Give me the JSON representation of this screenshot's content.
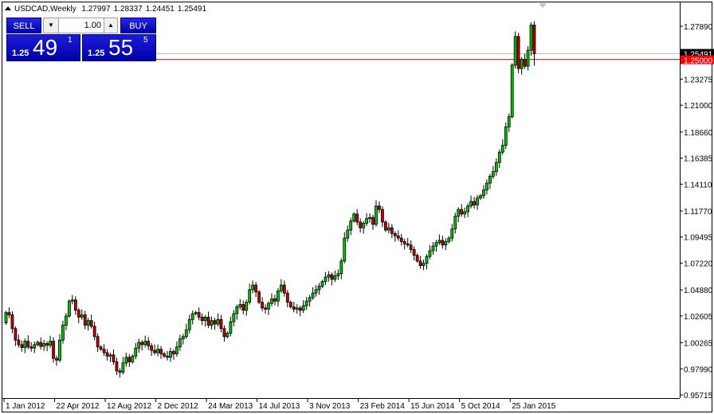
{
  "header": {
    "symbol": "USDCAD,Weekly",
    "open": "1.27997",
    "high": "1.28337",
    "low": "1.24451",
    "close": "1.25491"
  },
  "trade_panel": {
    "sell_label": "SELL",
    "buy_label": "BUY",
    "lot": "1.00",
    "sell_prefix": "1.25",
    "sell_big": "49",
    "sell_pip": "1",
    "buy_prefix": "1.25",
    "buy_big": "55",
    "buy_pip": "5"
  },
  "colors": {
    "bull": "#00c800",
    "bear": "#c80000",
    "ask_line": "#ff0000",
    "bid_line": "#c0c0c0",
    "panel_blue": "#0000c8"
  },
  "chart_data": {
    "type": "candlestick",
    "symbol": "USDCAD",
    "timeframe": "Weekly",
    "ylim": [
      0.95715,
      1.2789
    ],
    "y_ticks": [
      "1.27890",
      "1.23275",
      "1.21000",
      "1.18660",
      "1.16385",
      "1.14110",
      "1.11770",
      "1.09495",
      "1.07220",
      "1.04880",
      "1.02605",
      "1.00265",
      "0.97990",
      "0.95715"
    ],
    "x_ticks": [
      {
        "label": "1 Jan 2012",
        "week": 0
      },
      {
        "label": "22 Apr 2012",
        "week": 16
      },
      {
        "label": "12 Aug 2012",
        "week": 32
      },
      {
        "label": "2 Dec 2012",
        "week": 48
      },
      {
        "label": "24 Mar 2013",
        "week": 64
      },
      {
        "label": "14 Jul 2013",
        "week": 80
      },
      {
        "label": "3 Nov 2013",
        "week": 96
      },
      {
        "label": "23 Feb 2014",
        "week": 112
      },
      {
        "label": "15 Jun 2014",
        "week": 128
      },
      {
        "label": "5 Oct 2014",
        "week": 144
      },
      {
        "label": "25 Jan 2015",
        "week": 160
      }
    ],
    "bid_label": "1.25491",
    "bid": 1.25491,
    "level_label": "1.25000",
    "level": 1.25,
    "first_open": 1.02,
    "typical_wick": 0.004,
    "last_candle": {
      "open": 1.27997,
      "high": 1.28337,
      "low": 1.24451,
      "close": 1.25491
    },
    "close": [
      1.029,
      1.027,
      1.015,
      1.005,
      1.001,
      0.9985,
      1.004,
      0.999,
      0.998,
      1.001,
      1.003,
      0.9995,
      1.002,
      1.0005,
      1.004,
      0.989,
      0.9875,
      1.005,
      1.018,
      1.026,
      1.039,
      1.04,
      1.031,
      1.025,
      1.027,
      1.018,
      1.022,
      1.017,
      1.008,
      0.999,
      0.997,
      0.994,
      0.991,
      0.992,
      0.986,
      0.978,
      0.977,
      0.985,
      0.99,
      0.986,
      0.991,
      0.998,
      1.003,
      1.001,
      1.004,
      1.0,
      0.996,
      0.994,
      0.997,
      0.993,
      0.991,
      0.99,
      0.995,
      0.993,
      0.999,
      1.006,
      1.008,
      1.014,
      1.023,
      1.028,
      1.029,
      1.025,
      1.022,
      1.025,
      1.018,
      1.022,
      1.019,
      1.023,
      1.015,
      1.008,
      1.011,
      1.021,
      1.028,
      1.034,
      1.036,
      1.031,
      1.038,
      1.049,
      1.053,
      1.047,
      1.038,
      1.033,
      1.032,
      1.037,
      1.041,
      1.039,
      1.048,
      1.053,
      1.046,
      1.038,
      1.034,
      1.032,
      1.033,
      1.031,
      1.035,
      1.039,
      1.042,
      1.046,
      1.049,
      1.052,
      1.056,
      1.06,
      1.062,
      1.058,
      1.061,
      1.063,
      1.074,
      1.094,
      1.101,
      1.109,
      1.115,
      1.108,
      1.103,
      1.107,
      1.111,
      1.112,
      1.106,
      1.122,
      1.119,
      1.108,
      1.101,
      1.103,
      1.098,
      1.096,
      1.094,
      1.091,
      1.089,
      1.088,
      1.084,
      1.079,
      1.074,
      1.07,
      1.072,
      1.078,
      1.083,
      1.087,
      1.09,
      1.092,
      1.088,
      1.091,
      1.094,
      1.102,
      1.113,
      1.119,
      1.115,
      1.117,
      1.122,
      1.126,
      1.123,
      1.129,
      1.131,
      1.136,
      1.142,
      1.148,
      1.152,
      1.16,
      1.169,
      1.175,
      1.191,
      1.2,
      1.245,
      1.27,
      1.242,
      1.25,
      1.244,
      1.258,
      1.28,
      1.25491
    ]
  }
}
